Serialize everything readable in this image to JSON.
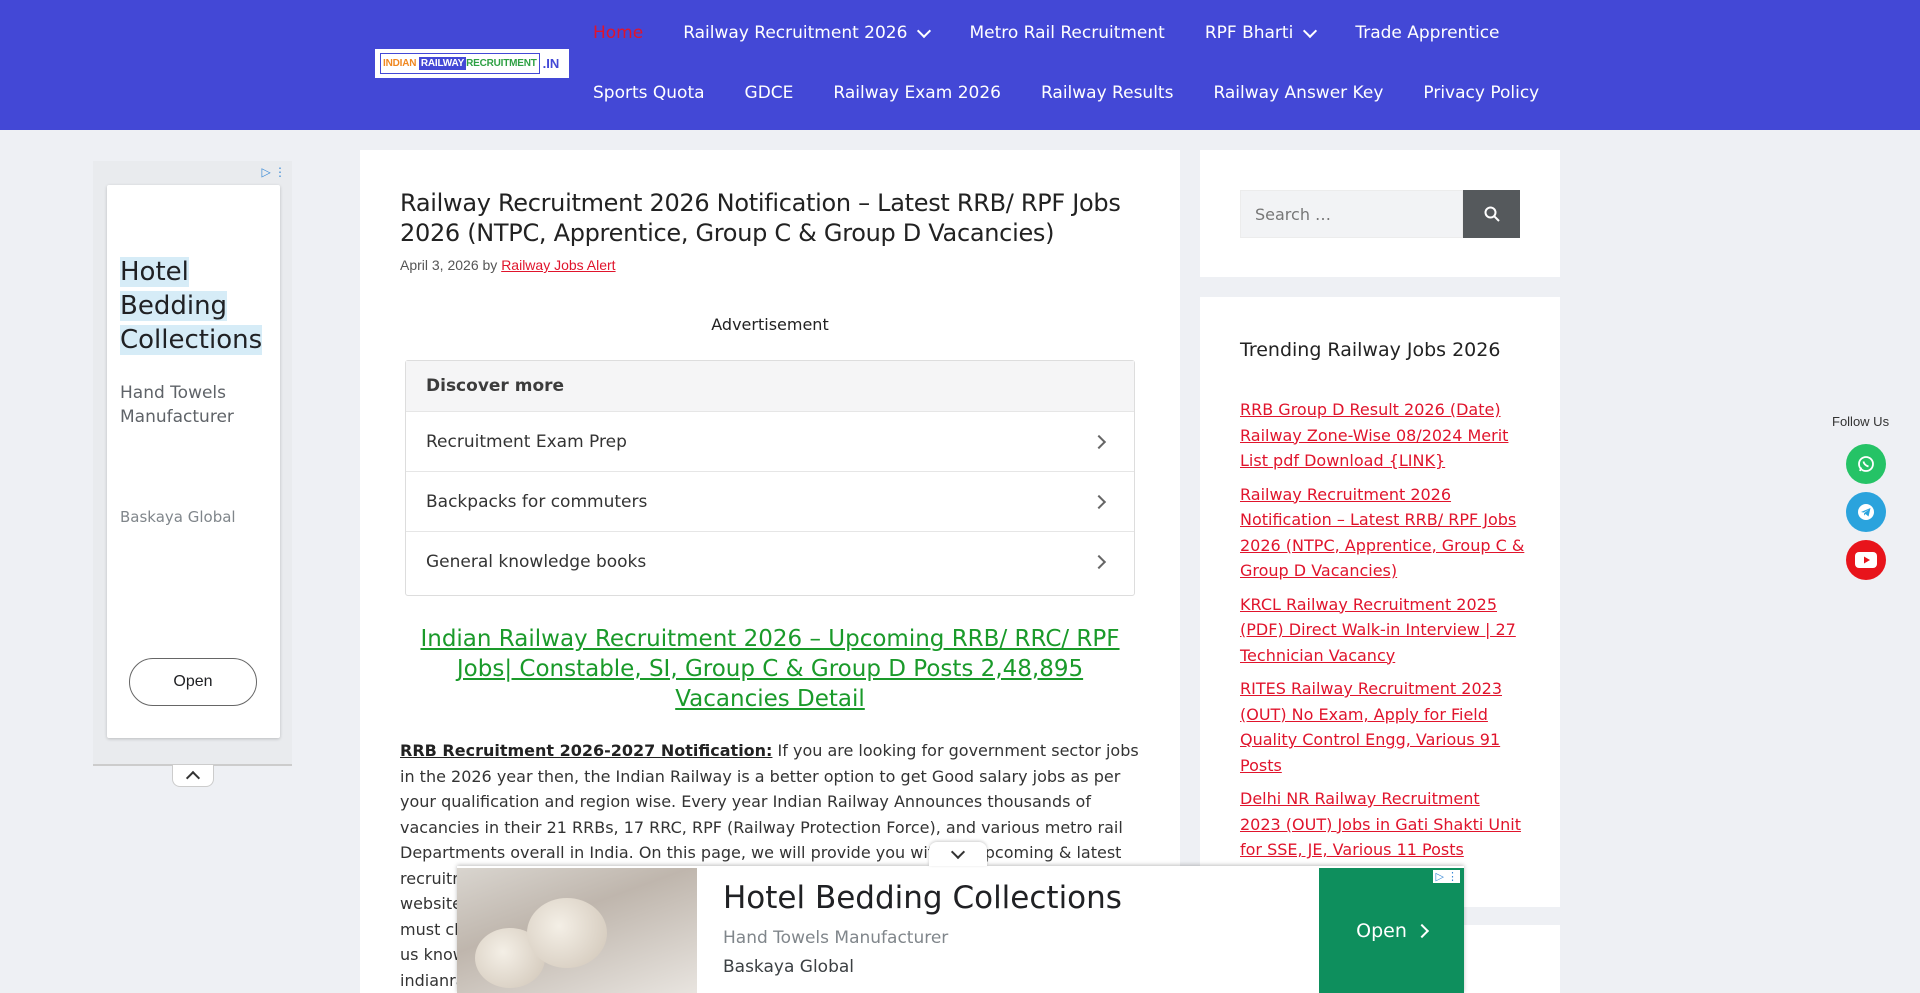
{
  "logo": {
    "part1": "INDIAN ",
    "part2": "RAILWAY",
    "part3": "RECRUITMENT",
    "tld": ".IN"
  },
  "nav": {
    "row1": [
      "Home",
      "Railway Recruitment 2026",
      "Metro Rail Recruitment",
      "RPF Bharti",
      "Trade Apprentice"
    ],
    "row2": [
      "Sports Quota",
      "GDCE",
      "Railway Exam 2026",
      "Railway Results",
      "Railway Answer Key",
      "Privacy Policy"
    ]
  },
  "left_ad": {
    "headline": [
      "Hotel",
      "Bedding",
      "Collections"
    ],
    "subtitle": "Hand Towels Manufacturer",
    "advertiser": "Baskaya Global",
    "button": "Open"
  },
  "article": {
    "title": "Railway Recruitment 2026 Notification – Latest RRB/ RPF Jobs 2026 (NTPC, Apprentice, Group C & Group D Vacancies)",
    "date": "April 3, 2026",
    "by": "by",
    "author": "Railway Jobs Alert",
    "ad_label": "Advertisement",
    "discover": {
      "heading": "Discover more",
      "items": [
        "Recruitment Exam Prep",
        "Backpacks for commuters",
        "General knowledge books"
      ]
    },
    "green_link": "Indian Railway Recruitment 2026 – Upcoming RRB/ RRC/ RPF Jobs| Constable, SI, Group C & Group D Posts 2,48,895 Vacancies Detail",
    "lead": "RRB Recruitment 2026-2027 Notification:",
    "body": " If you are looking for government sector jobs in the 2026 year then, the Indian Railway is a better option to get Good salary jobs as per your qualification and region wise. Every year Indian Railway Announces thousands of vacancies in their 21 RRBs, 17 RRC, RPF (Railway Protection Force), and various metro rail Departments overall in India. On this page, we will provide you with all Upcoming & latest recruitment notification detail that is p",
    "fragments": [
      "website",
      "must ch",
      "us know",
      "indianra"
    ]
  },
  "search": {
    "placeholder": "Search …"
  },
  "trending": {
    "heading": "Trending Railway Jobs 2026",
    "items": [
      "RRB Group D Result 2026 (Date) Railway Zone-Wise 08/2024 Merit List pdf Download {LINK}",
      "Railway Recruitment 2026 Notification – Latest RRB/ RPF Jobs 2026 (NTPC, Apprentice, Group C & Group D Vacancies)",
      "KRCL Railway Recruitment 2025 (PDF) Direct Walk-in Interview | 27 Technician Vacancy",
      "RITES Railway Recruitment 2023 (OUT) No Exam, Apply for Field Quality Control Engg, Various 91 Posts",
      "Delhi NR Railway Recruitment 2023 (OUT) Jobs in Gati Shakti Unit for SSE, JE, Various 11 Posts"
    ]
  },
  "follow": {
    "label": "Follow Us"
  },
  "bottom_ad": {
    "headline": "Hotel Bedding Collections",
    "subtitle": "Hand Towels Manufacturer",
    "advertiser": "Baskaya Global",
    "button": "Open"
  },
  "colors": {
    "header": "#4348d6",
    "active": "#e0142c",
    "link_red": "#e0142c",
    "link_green": "#1a9a2a",
    "ad_open": "#0e8f5d"
  }
}
